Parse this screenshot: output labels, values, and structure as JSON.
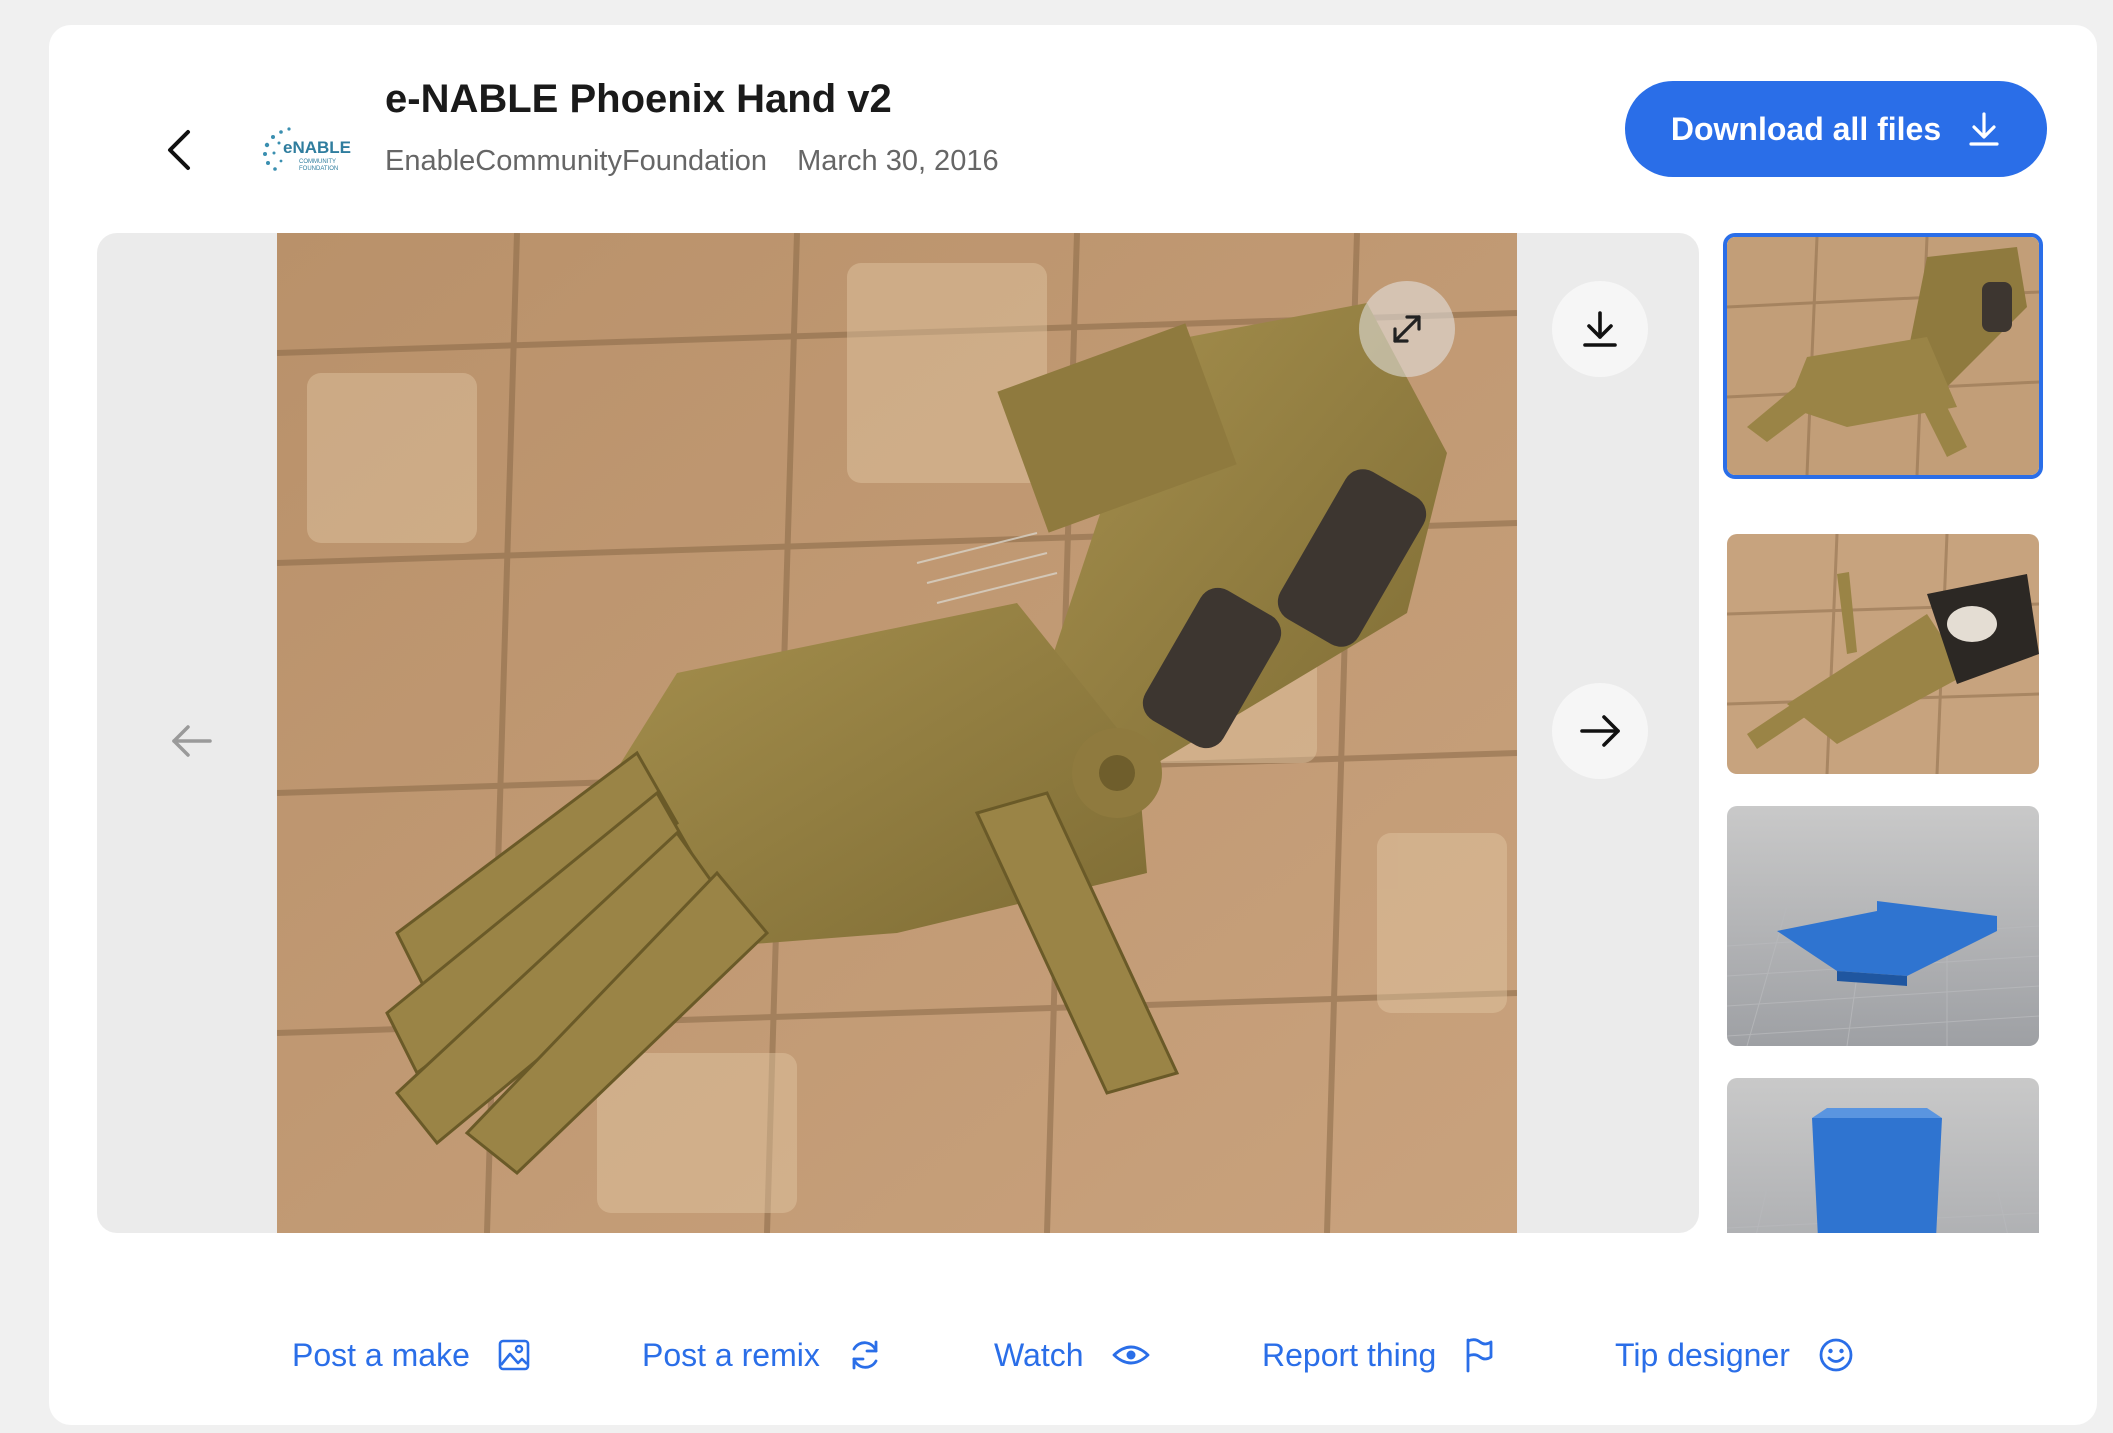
{
  "header": {
    "title": "e-NABLE Phoenix Hand v2",
    "author": "EnableCommunityFoundation",
    "date": "March 30, 2016",
    "logo_text": "eNABLE",
    "logo_subtext": "COMMUNITY FOUNDATION",
    "download_all_label": "Download all files"
  },
  "viewer": {
    "icons": {
      "prev": "arrow-left-icon",
      "next": "arrow-right-icon",
      "expand": "expand-icon",
      "download": "download-icon"
    }
  },
  "thumbnails": [
    {
      "subject": "assembled hand on tiles",
      "selected": true
    },
    {
      "subject": "hand with dark straps on tiles",
      "selected": false
    },
    {
      "subject": "blue printed plate render",
      "selected": false
    },
    {
      "subject": "blue printed block render",
      "selected": false
    }
  ],
  "actions": [
    {
      "label": "Post a make",
      "icon": "image-icon"
    },
    {
      "label": "Post a remix",
      "icon": "refresh-icon"
    },
    {
      "label": "Watch",
      "icon": "eye-icon"
    },
    {
      "label": "Report thing",
      "icon": "flag-icon"
    },
    {
      "label": "Tip designer",
      "icon": "smiley-icon"
    }
  ],
  "colors": {
    "accent": "#2a6ee8",
    "page_background": "#f0f0f0",
    "card_background": "#ffffff"
  }
}
